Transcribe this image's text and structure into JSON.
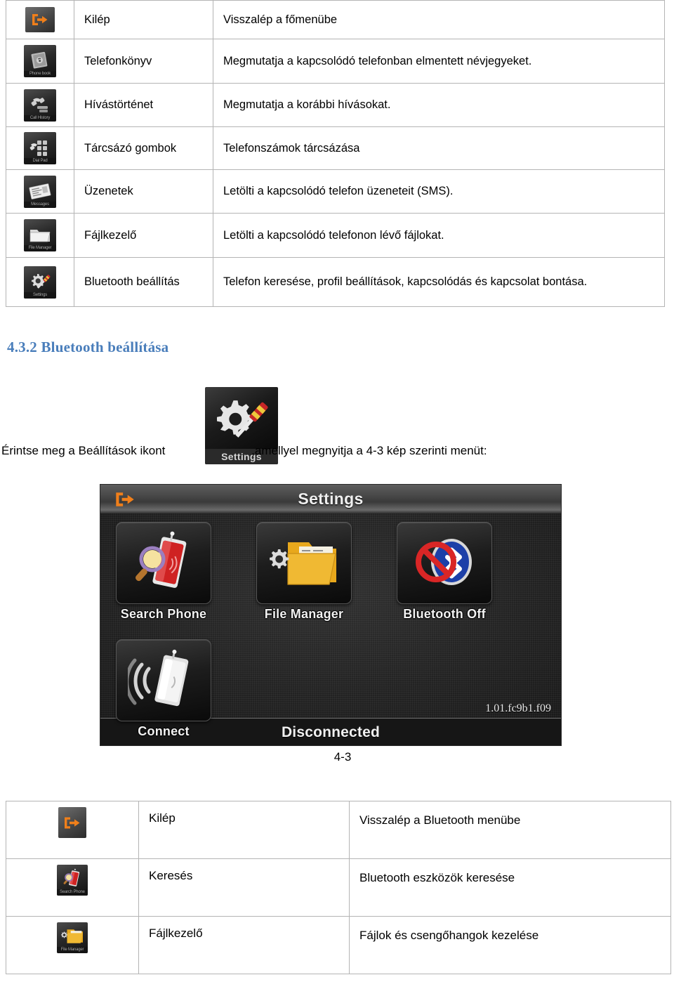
{
  "top_table": {
    "rows": [
      {
        "icon": "exit-icon",
        "icon_caption": "",
        "label": "Kilép",
        "desc": "Visszalép a főmenübe"
      },
      {
        "icon": "phonebook-icon",
        "icon_caption": "Phone book",
        "label": "Telefonkönyv",
        "desc": "Megmutatja a kapcsolódó telefonban elmentett névjegyeket."
      },
      {
        "icon": "call-history-icon",
        "icon_caption": "Call History",
        "label": "Hívástörténet",
        "desc": "Megmutatja a korábbi hívásokat."
      },
      {
        "icon": "dial-pad-icon",
        "icon_caption": "Dial Pad",
        "label": "Tárcsázó gombok",
        "desc": "Telefonszámok tárcsázása"
      },
      {
        "icon": "messages-icon",
        "icon_caption": "Messages",
        "label": "Üzenetek",
        "desc": "Letölti a kapcsolódó telefon üzeneteit (SMS)."
      },
      {
        "icon": "file-manager-icon",
        "icon_caption": "File Manager",
        "label": "Fájlkezelő",
        "desc": "Letölti a kapcsolódó telefonon lévő fájlokat."
      },
      {
        "icon": "settings-icon",
        "icon_caption": "Settings",
        "label": "Bluetooth beállítás",
        "desc": "Telefon keresése, profil beállítások, kapcsolódás és kapcsolat bontása."
      }
    ]
  },
  "heading": {
    "text": "4.3.2 Bluetooth beállítása",
    "color": "#4a7ebb"
  },
  "instruction": {
    "before": "Érintse meg a Beállítások ikont",
    "after": ",amellyel megnyitja a 4-3 kép szerinti menüt:",
    "icon_caption": "Settings",
    "icon_name": "settings-icon"
  },
  "device": {
    "exit_icon": "exit-icon",
    "title": "Settings",
    "tiles": [
      {
        "id": "search",
        "icon": "search-phone-icon",
        "label": "Search Phone"
      },
      {
        "id": "files",
        "icon": "file-manager-icon",
        "label": "File Manager"
      },
      {
        "id": "btoff",
        "icon": "bluetooth-off-icon",
        "label": "Bluetooth Off"
      },
      {
        "id": "connect",
        "icon": "connect-icon",
        "label": "Connect"
      }
    ],
    "version": "1.01.fc9b1.f09",
    "status": "Disconnected"
  },
  "figure_caption": "4-3",
  "bottom_table": {
    "rows": [
      {
        "icon": "exit-icon",
        "icon_caption": "",
        "label": "Kilép",
        "desc": "Visszalép a Bluetooth menübe"
      },
      {
        "icon": "search-phone-icon",
        "icon_caption": "Search Phone",
        "label": "Keresés",
        "desc": "Bluetooth eszközök keresése"
      },
      {
        "icon": "file-manager-icon",
        "icon_caption": "File Manager",
        "label": "Fájlkezelő",
        "desc": "Fájlok és csengőhangok kezelése"
      }
    ]
  },
  "colors": {
    "accent_orange": "#f07f1a",
    "heading_blue": "#4a7ebb",
    "table_border": "#b4b4b4",
    "device_dark": "#1a1a1a"
  }
}
